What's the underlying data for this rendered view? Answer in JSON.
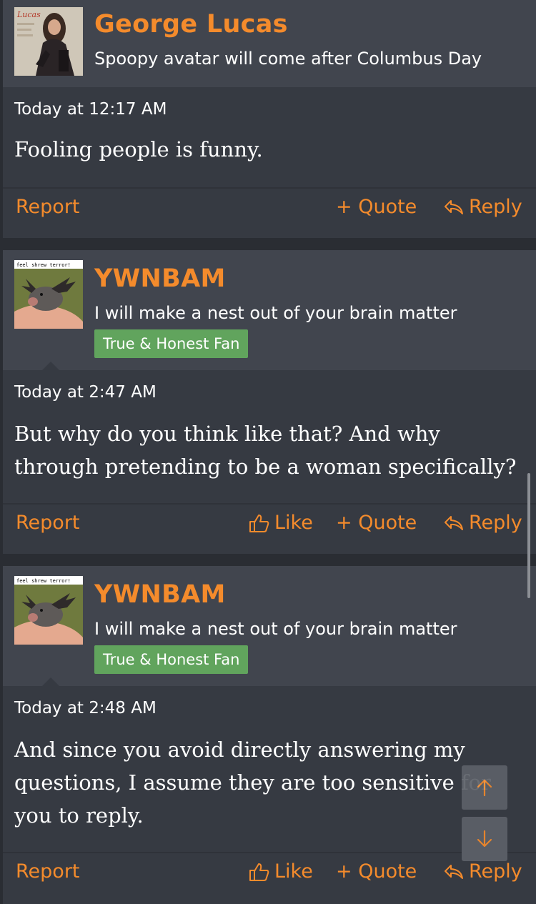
{
  "posts": [
    {
      "username": "George Lucas",
      "user_title": "Spoopy avatar will come after Columbus Day",
      "avatar_text": "Lucas",
      "timestamp": "Today at 12:17 AM",
      "message": "Fooling people is funny.",
      "actions": {
        "report": "Report",
        "quote": "+ Quote",
        "reply": "Reply"
      }
    },
    {
      "username": "YWNBAM",
      "user_title": "I will make a nest out of your brain matter",
      "avatar_caption": "feel shrew terror!",
      "banner": "True & Honest Fan",
      "timestamp": "Today at 2:47 AM",
      "message": "But why do you think like that? And why through pretending to be a woman specifically?",
      "actions": {
        "report": "Report",
        "like": "Like",
        "quote": "+ Quote",
        "reply": "Reply"
      }
    },
    {
      "username": "YWNBAM",
      "user_title": "I will make a nest out of your brain matter",
      "avatar_caption": "feel shrew terror!",
      "banner": "True & Honest Fan",
      "timestamp": "Today at 2:48 AM",
      "message": "And since you avoid directly answering my questions, I assume they are too sensitive for you to reply.",
      "actions": {
        "report": "Report",
        "like": "Like",
        "quote": "+ Quote",
        "reply": "Reply"
      }
    }
  ],
  "icons": {
    "like": "thumbs-up-icon",
    "reply": "reply-arrow-icon",
    "scroll_up": "arrow-up-icon",
    "scroll_down": "arrow-down-icon"
  },
  "colors": {
    "accent": "#f48b2c",
    "banner": "#61a45d",
    "post_bg": "#363a42",
    "header_bg": "#41454e",
    "page_bg": "#2a2d33"
  }
}
